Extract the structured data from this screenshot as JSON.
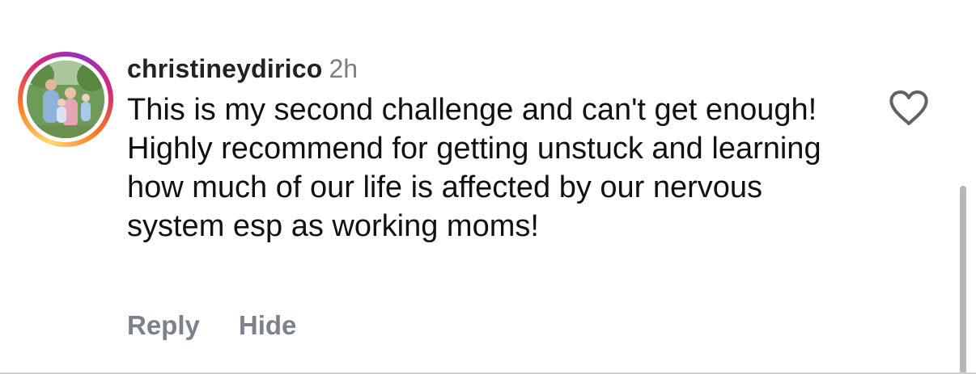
{
  "comment": {
    "username": "christineydirico",
    "time": "2h",
    "text": "This is my second challenge and can't get enough! Highly recommend for getting unstuck and learning how much of our life is affected by our nervous system esp as working moms!",
    "actions": {
      "reply": "Reply",
      "hide": "Hide"
    },
    "liked": false
  },
  "colors": {
    "username": "#222222",
    "timestamp": "#7a7f87",
    "body_text": "#111111",
    "action_text": "#7c828b",
    "ring_gradient": [
      "#feda75",
      "#fa7e1e",
      "#d62976",
      "#962fbf"
    ]
  },
  "icons": {
    "like": "heart-outline-icon"
  }
}
